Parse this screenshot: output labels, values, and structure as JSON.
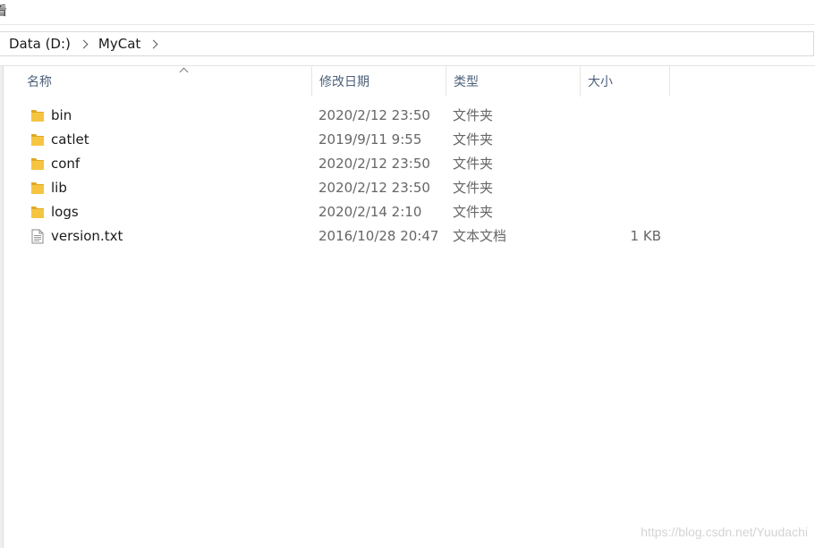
{
  "window": {
    "top_label": "看"
  },
  "breadcrumb": {
    "items": [
      "Data (D:)",
      "MyCat"
    ]
  },
  "columns": {
    "name": "名称",
    "date": "修改日期",
    "type": "类型",
    "size": "大小"
  },
  "files": [
    {
      "name": "bin",
      "date": "2020/2/12 23:50",
      "type": "文件夹",
      "size": "",
      "icon": "folder-icon"
    },
    {
      "name": "catlet",
      "date": "2019/9/11 9:55",
      "type": "文件夹",
      "size": "",
      "icon": "folder-icon"
    },
    {
      "name": "conf",
      "date": "2020/2/12 23:50",
      "type": "文件夹",
      "size": "",
      "icon": "folder-icon"
    },
    {
      "name": "lib",
      "date": "2020/2/12 23:50",
      "type": "文件夹",
      "size": "",
      "icon": "folder-icon"
    },
    {
      "name": "logs",
      "date": "2020/2/14 2:10",
      "type": "文件夹",
      "size": "",
      "icon": "folder-icon"
    },
    {
      "name": "version.txt",
      "date": "2016/10/28 20:47",
      "type": "文本文档",
      "size": "1 KB",
      "icon": "text-file-icon"
    }
  ],
  "watermark": "https://blog.csdn.net/Yuudachi",
  "colors": {
    "folder": "#f5c542",
    "folder_dark": "#e0a820",
    "header_text": "#4c607a"
  }
}
